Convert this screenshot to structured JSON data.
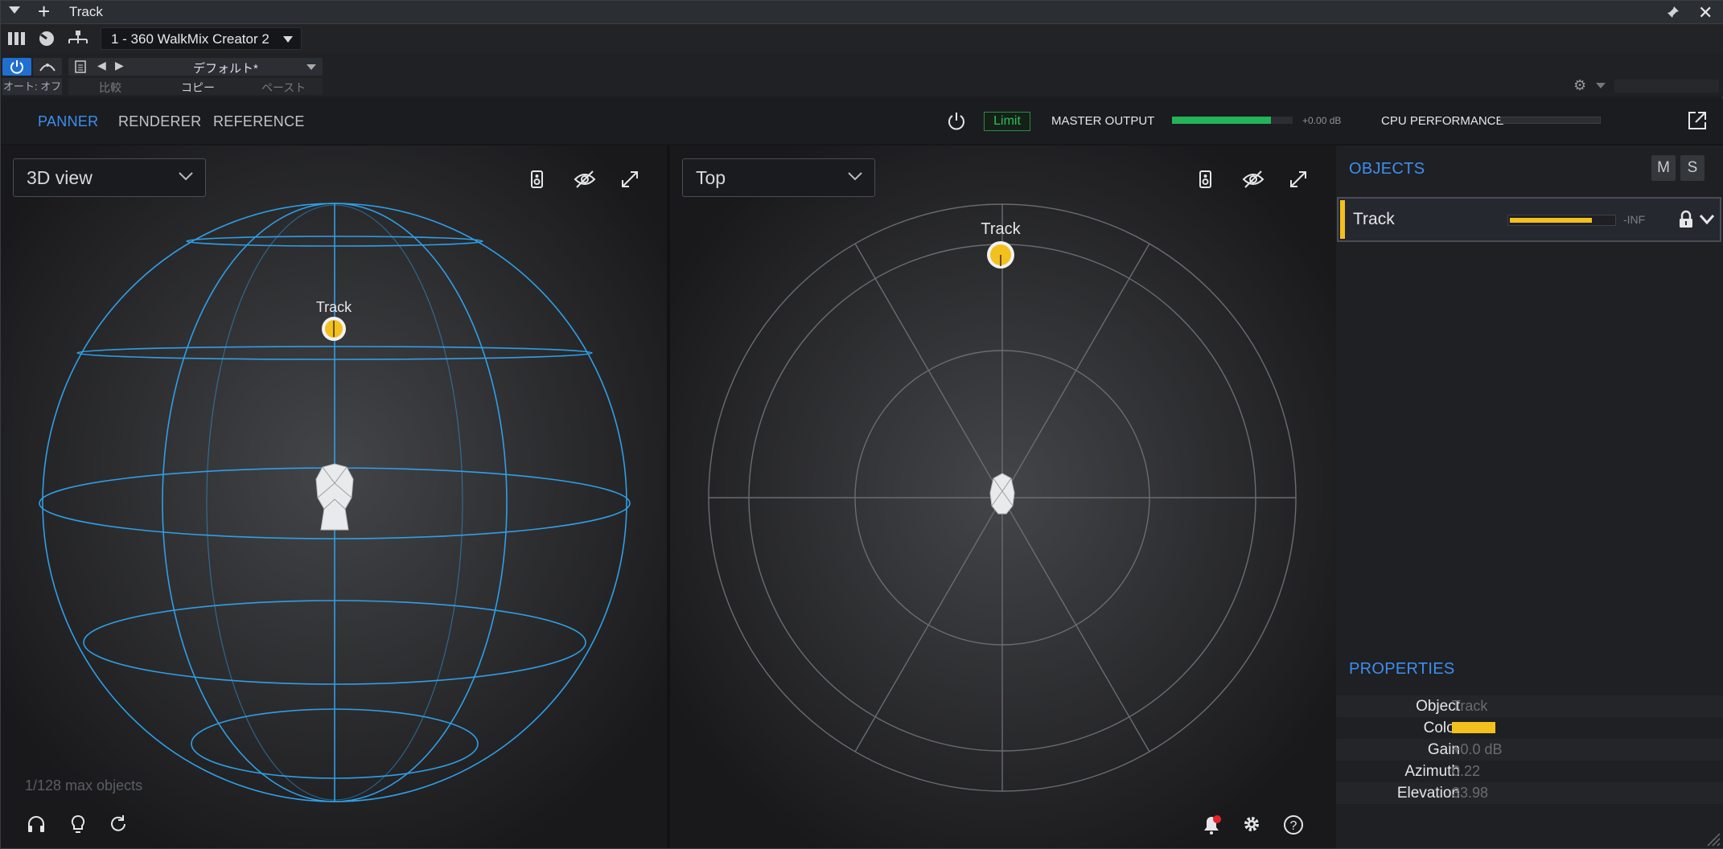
{
  "host": {
    "title": "Track",
    "plugin_name": "1 - 360 WalkMix Creator 2",
    "auto_label": "オート: オフ",
    "preset_name": "デフォルト*",
    "compare_label": "比較",
    "copy_label": "コピー",
    "paste_label": "ペースト"
  },
  "header": {
    "tabs": [
      "PANNER",
      "RENDERER",
      "REFERENCE"
    ],
    "active_tab": "PANNER",
    "limit_label": "Limit",
    "master_label": "MASTER OUTPUT",
    "master_db": "+0.00 dB",
    "master_level": 0.82,
    "cpu_label": "CPU PERFORMANCE",
    "cpu_level": 0.0
  },
  "view3d": {
    "selector": "3D view",
    "object_label": "Track",
    "max_objects": "1/128 max objects"
  },
  "viewtop": {
    "selector": "Top",
    "object_label": "Track"
  },
  "objects": {
    "heading": "OBJECTS",
    "mute_label": "M",
    "solo_label": "S",
    "items": [
      {
        "name": "Track",
        "level_text": "-INF",
        "level": 0.78,
        "color": "#f4c01e"
      }
    ]
  },
  "properties": {
    "heading": "PROPERTIES",
    "rows": [
      {
        "key": "Object",
        "value": "Track"
      },
      {
        "key": "Color",
        "value": ""
      },
      {
        "key": "Gain",
        "value": "+0.0 dB"
      },
      {
        "key": "Azimuth",
        "value": "0.22"
      },
      {
        "key": "Elevation",
        "value": "33.98"
      }
    ]
  },
  "colors": {
    "accent": "#3d8ef0",
    "object": "#f4c01e",
    "meter": "#23b45a",
    "sphere": "#2f9fe6"
  }
}
